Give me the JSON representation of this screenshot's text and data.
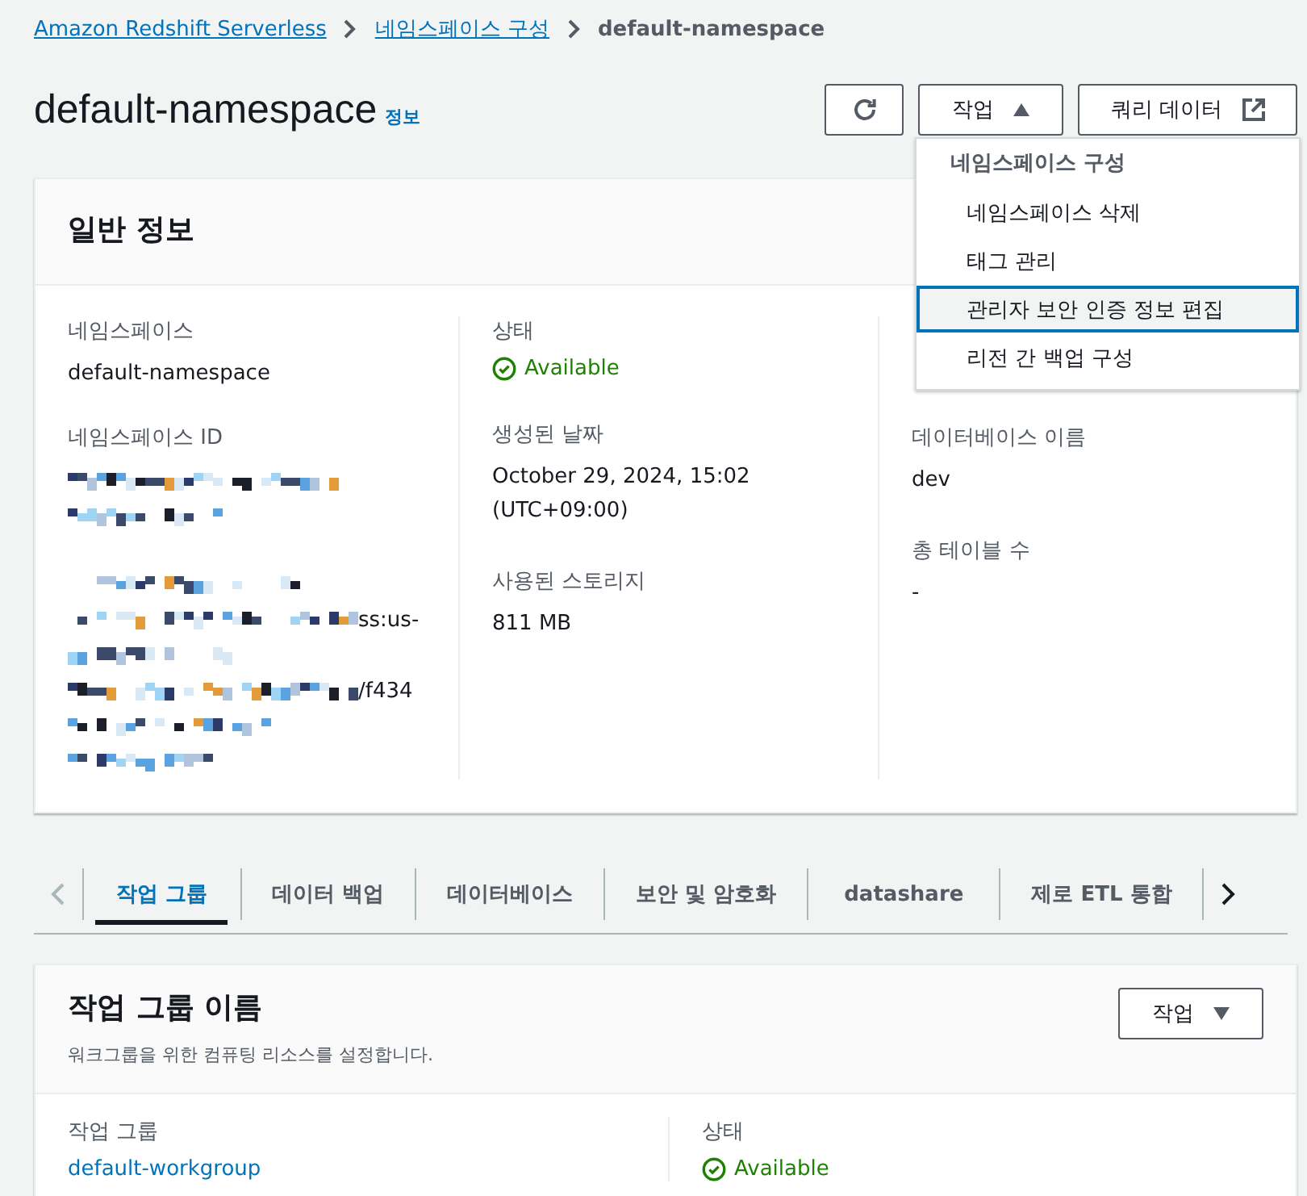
{
  "breadcrumb": [
    {
      "label": "Amazon Redshift Serverless",
      "link": true
    },
    {
      "label": "네임스페이스 구성",
      "link": true
    },
    {
      "label": "default-namespace",
      "link": false
    }
  ],
  "header": {
    "title": "default-namespace",
    "info": "정보",
    "actions_button": "작업",
    "query_button": "쿼리 데이터"
  },
  "actions_menu": {
    "expanded": true,
    "group": "네임스페이스 구성",
    "items": [
      {
        "label": "네임스페이스 삭제",
        "selected": false
      },
      {
        "label": "태그 관리",
        "selected": false
      },
      {
        "label": "관리자 보안 인증 정보 편집",
        "selected": true
      },
      {
        "label": "리전 간 백업 구성",
        "selected": false
      }
    ]
  },
  "general": {
    "title": "일반 정보",
    "columns": [
      [
        {
          "label": "네임스페이스",
          "kind": "text",
          "value": "default-namespace"
        },
        {
          "label": "네임스페이스 ID",
          "kind": "redacted",
          "lines": [
            {
              "kind": "redacted"
            },
            {
              "kind": "redacted"
            }
          ]
        },
        {
          "kind": "redacted",
          "lines": [
            {
              "kind": "redacted"
            },
            {
              "kind": "partly",
              "text": "ss:us-"
            },
            {
              "kind": "redacted"
            },
            {
              "kind": "partly",
              "text": "/f434"
            },
            {
              "kind": "redacted"
            },
            {
              "kind": "redacted"
            }
          ]
        }
      ],
      [
        {
          "label": "상태",
          "kind": "status",
          "value": "Available"
        },
        {
          "label": "생성된 날짜",
          "kind": "text",
          "value": "October 29, 2024, 15:02 (UTC+09:00)"
        },
        {
          "label": "사용된 스토리지",
          "kind": "text",
          "value": "811 MB"
        }
      ],
      [
        {
          "label": "데이터베이스 이름",
          "kind": "text",
          "value": "dev"
        },
        {
          "label": "총 테이블 수",
          "kind": "text",
          "value": "-"
        }
      ]
    ]
  },
  "tabs": [
    {
      "label": "작업 그룹",
      "selected": true
    },
    {
      "label": "데이터 백업",
      "selected": false
    },
    {
      "label": "데이터베이스",
      "selected": false
    },
    {
      "label": "보안 및 암호화",
      "selected": false
    },
    {
      "label": "datashare",
      "selected": false
    },
    {
      "label": "제로 ETL 통합",
      "selected": false
    }
  ],
  "workgroup": {
    "title": "작업 그룹 이름",
    "description": "워크그룹을 위한 컴퓨팅 리소스를 설정합니다.",
    "actions_button": "작업",
    "fields": [
      {
        "label": "작업 그룹",
        "kind": "link",
        "value": "default-workgroup"
      },
      {
        "label": "상태",
        "kind": "status",
        "value": "Available"
      }
    ]
  }
}
